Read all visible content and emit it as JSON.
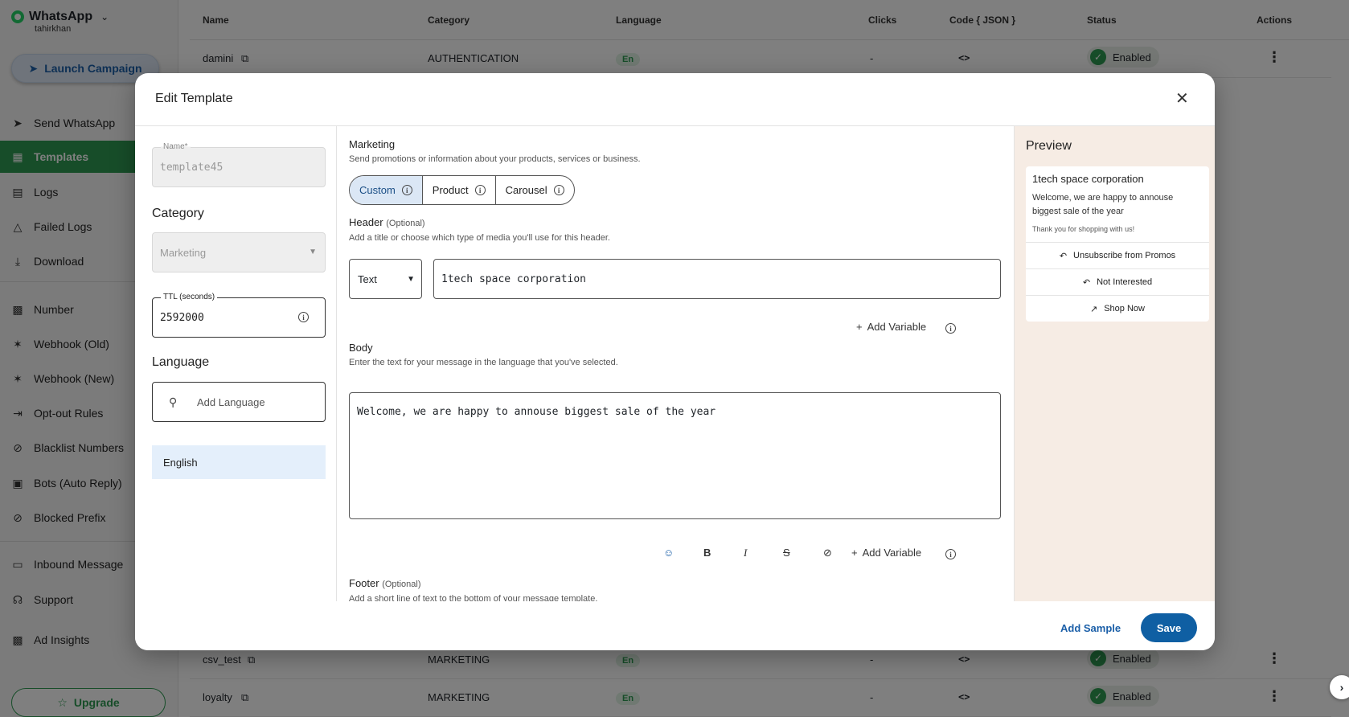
{
  "sidebar": {
    "brand_name": "WhatsApp",
    "brand_user": "tahirkhan",
    "launch_label": "Launch Campaign",
    "items": [
      {
        "label": "Send WhatsApp",
        "icon": "send-icon"
      },
      {
        "label": "Templates",
        "icon": "grid-icon"
      },
      {
        "label": "Logs",
        "icon": "document-icon"
      },
      {
        "label": "Failed Logs",
        "icon": "warning-icon"
      },
      {
        "label": "Download",
        "icon": "download-icon"
      },
      {
        "label": "Number",
        "icon": "number-icon"
      },
      {
        "label": "Webhook (Old)",
        "icon": "webhook-icon"
      },
      {
        "label": "Webhook (New)",
        "icon": "webhook-icon"
      },
      {
        "label": "Opt-out Rules",
        "icon": "exit-icon"
      },
      {
        "label": "Blacklist Numbers",
        "icon": "block-icon"
      },
      {
        "label": "Bots (Auto Reply)",
        "icon": "robot-icon"
      },
      {
        "label": "Blocked Prefix",
        "icon": "block-icon"
      },
      {
        "label": "Inbound Message",
        "icon": "inbox-icon"
      },
      {
        "label": "Support",
        "icon": "headset-icon"
      },
      {
        "label": "Ad Insights",
        "icon": "chart-icon"
      }
    ],
    "upgrade_label": "Upgrade"
  },
  "table": {
    "headers": [
      "Name",
      "Category",
      "Language",
      "Clicks",
      "Code { JSON }",
      "Status",
      "Actions"
    ],
    "rows": [
      {
        "name": "damini",
        "category": "AUTHENTICATION",
        "language": "En",
        "clicks": "-",
        "status": "Enabled"
      },
      {
        "name": "csv_test",
        "category": "MARKETING",
        "language": "En",
        "clicks": "-",
        "status": "Enabled"
      },
      {
        "name": "loyalty",
        "category": "MARKETING",
        "language": "En",
        "clicks": "-",
        "status": "Enabled"
      }
    ]
  },
  "modal": {
    "title": "Edit Template",
    "left": {
      "name_label": "Name*",
      "name_value": "template45",
      "category_title": "Category",
      "category_value": "Marketing",
      "ttl_label": "TTL (seconds)",
      "ttl_value": "2592000",
      "language_title": "Language",
      "language_placeholder": "Add Language",
      "language_selected": "English"
    },
    "middle": {
      "type_title": "Marketing",
      "type_subtitle": "Send promotions or information about your products, services or business.",
      "segments": [
        "Custom",
        "Product",
        "Carousel"
      ],
      "header_title": "Header",
      "header_optional": "(Optional)",
      "header_subtitle": "Add a title or choose which type of media you'll use for this header.",
      "header_type": "Text",
      "header_value": "1tech space corporation",
      "add_variable": "Add Variable",
      "body_title": "Body",
      "body_subtitle": "Enter the text for your message in the language that you've selected.",
      "body_value": "Welcome, we are happy to annouse biggest sale of the year",
      "footer_title": "Footer",
      "footer_optional": "(Optional)",
      "footer_subtitle": "Add a short line of text to the bottom of your message template."
    },
    "preview": {
      "title": "Preview",
      "header": "1tech space corporation",
      "body": "Welcome, we are happy to annouse biggest sale of the year",
      "footer": "Thank you for shopping with us!",
      "buttons": [
        "Unsubscribe from Promos",
        "Not Interested",
        "Shop Now"
      ]
    },
    "add_sample": "Add Sample",
    "save": "Save"
  },
  "colors": {
    "accent": "#2e9b52",
    "primary": "#0f5fa3",
    "preview_bg": "#f6ece4"
  }
}
